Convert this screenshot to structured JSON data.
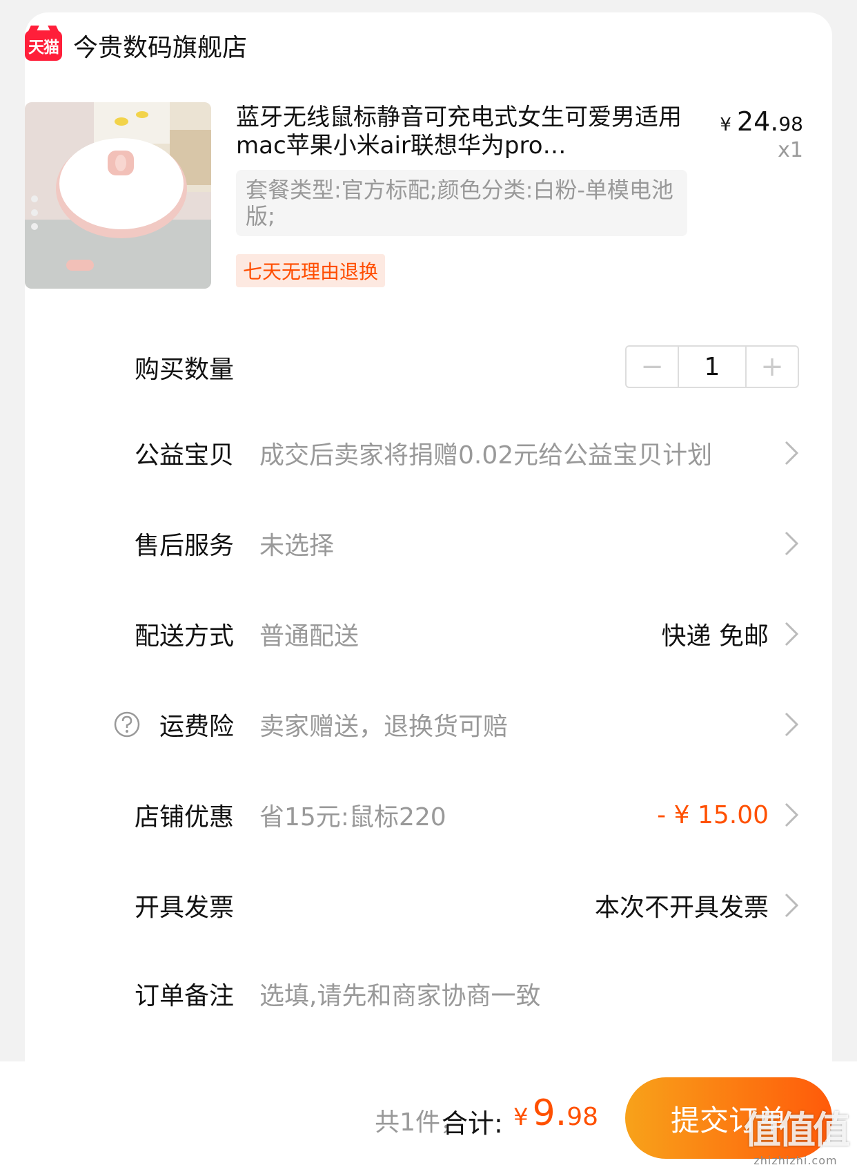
{
  "shop": {
    "logo_text": "天猫",
    "name": "今贵数码旗舰店"
  },
  "product": {
    "title": "蓝牙无线鼠标静音可充电式女生可爱男适用mac苹果小米air联想华为pro…",
    "price_symbol": "¥",
    "price_int": "24.",
    "price_dec": "98",
    "quantity_label": "x1",
    "sku": "套餐类型:官方标配;颜色分类:白粉-单模电池版;",
    "return_tag": "七天无理由退换"
  },
  "rows": {
    "quantity": {
      "label": "购买数量",
      "minus": "−",
      "value": "1",
      "plus": "+"
    },
    "charity": {
      "label": "公益宝贝",
      "value": "成交后卖家将捐赠0.02元给公益宝贝计划"
    },
    "after_sales": {
      "label": "售后服务",
      "value": "未选择"
    },
    "delivery": {
      "label": "配送方式",
      "value": "普通配送",
      "right": "快递 免邮"
    },
    "shipping_insurance": {
      "label": "运费险",
      "value": "卖家赠送，退换货可赔"
    },
    "store_discount": {
      "label": "店铺优惠",
      "value": "省15元:鼠标220",
      "right": "- ¥ 15.00"
    },
    "invoice": {
      "label": "开具发票",
      "right": "本次不开具发票"
    },
    "note": {
      "label": "订单备注",
      "placeholder": "选填,请先和商家协商一致"
    }
  },
  "footer": {
    "count_text": "共1件，",
    "total_label": "合计:",
    "total_symbol": "¥",
    "total_int": "9.",
    "total_dec": "98",
    "submit_label": "提交订单"
  },
  "watermark": {
    "main": "值值值",
    "sub": "zhizhizhi.com"
  },
  "icons": {
    "logo": "tmall-logo",
    "help": "question-circle-icon",
    "chevron": "chevron-right-icon"
  },
  "colors": {
    "accent": "#ff5000",
    "tag_bg": "#fde9e1",
    "button_start": "#f8a21a",
    "button_end": "#ff5a0a",
    "tmall_red": "#ff1f3a"
  }
}
